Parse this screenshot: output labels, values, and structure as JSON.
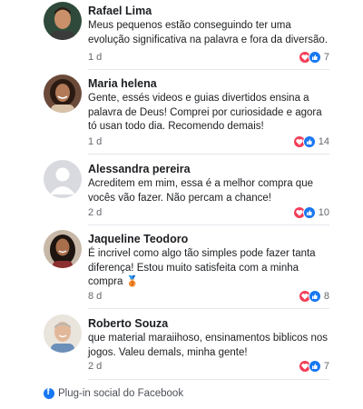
{
  "comments": [
    {
      "name": "Rafael Lima",
      "text": "Meus pequenos estão conseguindo ter uma evolução significativa na palavra e fora da diversão.",
      "age": "1 d",
      "reaction_count": "7",
      "avatar": "man-dark-hair-avatar"
    },
    {
      "name": "Maria helena",
      "text": "Gente, essés videos e guias divertidos ensina a palavra de Deus! Comprei por curiosidade e agora tó usan todo dia. Recomendo demais!",
      "age": "1 d",
      "reaction_count": "14",
      "avatar": "woman-curly-hair-avatar"
    },
    {
      "name": "Alessandra pereira",
      "text": "Acreditem em mim, essa é a melhor compra que vocês vão fazer. Não percam a chance!",
      "age": "2 d",
      "reaction_count": "10",
      "avatar": "default-user-avatar"
    },
    {
      "name": "Jaqueline Teodoro",
      "text": "É incrivel como algo tão simples pode fazer tanta diferença! Estou muito satisfeita com a minha compra 🥉",
      "age": "8 d",
      "reaction_count": "8",
      "avatar": "woman-long-hair-avatar"
    },
    {
      "name": "Roberto Souza",
      "text": "que material maraiihoso, ensinamentos biblicos nos jogos. Valeu demals, minha gente!",
      "age": "2 d",
      "reaction_count": "7",
      "avatar": "older-man-avatar"
    }
  ],
  "footer": {
    "plugin_label": "Plug-in social do Facebook",
    "icon": "facebook-icon"
  },
  "colors": {
    "love": "#f33e58",
    "like": "#1877f2",
    "facebook": "#1877f2",
    "meta_text": "#65676b"
  }
}
